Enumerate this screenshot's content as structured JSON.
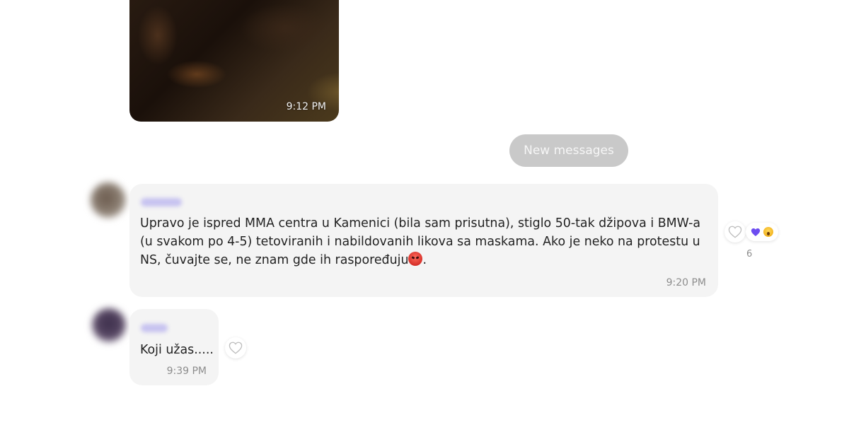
{
  "photo_message": {
    "time": "9:12 PM"
  },
  "divider": {
    "new_messages_label": "New messages"
  },
  "messages": [
    {
      "text_before_emoji": "Upravo je ispred MMA centra u Kamenici (bila sam prisutna), stiglo 50-tak džipova i BMW-a (u svakom po 4-5) tetoviranih i nabildovanih likova sa maskama. Ako je neko na protestu u NS, čuvajte se, ne znam gde ih raspoređuju",
      "emoji": "angry-face",
      "text_after_emoji": ".",
      "time": "9:20 PM",
      "reactions": {
        "icons": [
          "purple-heart",
          "face-screaming"
        ],
        "count": "6"
      }
    },
    {
      "text": "Koji užas.....",
      "time": "9:39 PM"
    }
  ],
  "colors": {
    "bubble_background": "#f4f4f4",
    "new_messages_pill": "#c9c9c9",
    "reaction_heart": "#6c4cf0"
  }
}
